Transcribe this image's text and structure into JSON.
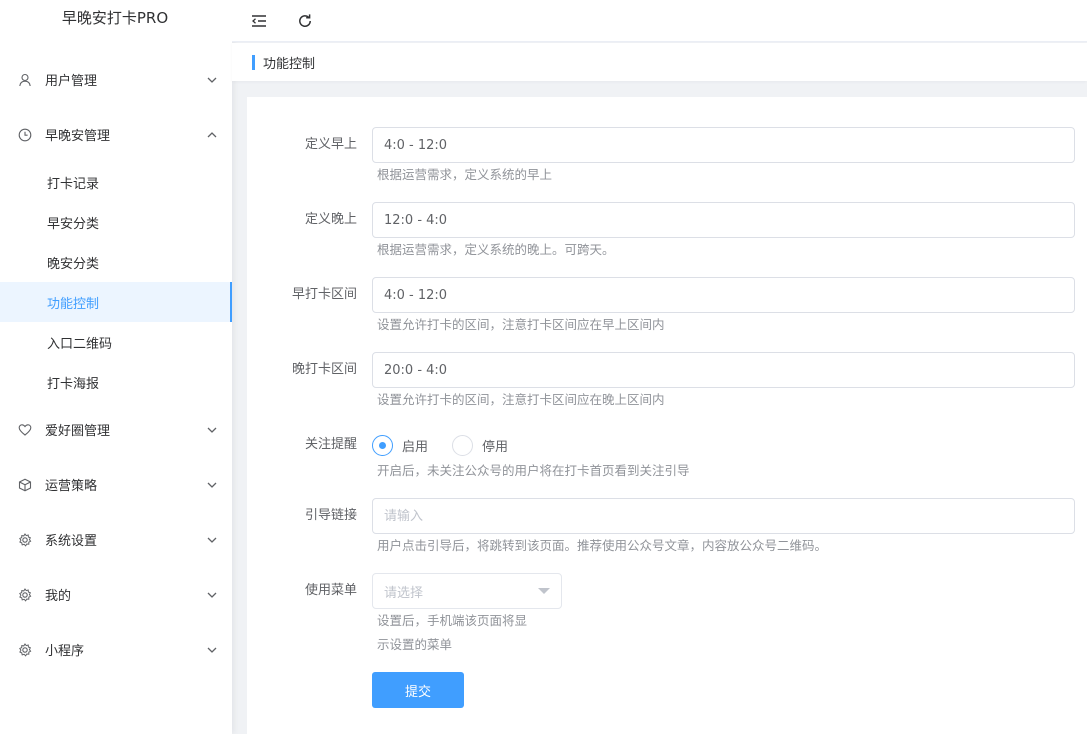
{
  "app": {
    "title": "早晚安打卡PRO"
  },
  "sidebar": {
    "items": [
      {
        "label": "用户管理",
        "icon": "user-icon",
        "expanded": false
      },
      {
        "label": "早晚安管理",
        "icon": "clock-icon",
        "expanded": true,
        "children": [
          {
            "label": "打卡记录"
          },
          {
            "label": "早安分类"
          },
          {
            "label": "晚安分类"
          },
          {
            "label": "功能控制",
            "active": true
          },
          {
            "label": "入口二维码"
          },
          {
            "label": "打卡海报"
          }
        ]
      },
      {
        "label": "爱好圈管理",
        "icon": "heart-icon",
        "expanded": false
      },
      {
        "label": "运营策略",
        "icon": "cube-icon",
        "expanded": false
      },
      {
        "label": "系统设置",
        "icon": "gear-icon",
        "expanded": false
      },
      {
        "label": "我的",
        "icon": "gear-icon",
        "expanded": false
      },
      {
        "label": "小程序",
        "icon": "gear-icon",
        "expanded": false
      }
    ]
  },
  "breadcrumb": {
    "current": "功能控制"
  },
  "form": {
    "morning": {
      "label": "定义早上",
      "value": "4:0 - 12:0",
      "help": "根据运营需求，定义系统的早上"
    },
    "evening": {
      "label": "定义晚上",
      "value": "12:0 - 4:0",
      "help": "根据运营需求，定义系统的晚上。可跨天。"
    },
    "morning_range": {
      "label": "早打卡区间",
      "value": "4:0 - 12:0",
      "help": "设置允许打卡的区间，注意打卡区间应在早上区间内"
    },
    "evening_range": {
      "label": "晚打卡区间",
      "value": "20:0 - 4:0",
      "help": "设置允许打卡的区间，注意打卡区间应在晚上区间内"
    },
    "follow_remind": {
      "label": "关注提醒",
      "options": [
        "启用",
        "停用"
      ],
      "selected": "启用",
      "help": "开启后，未关注公众号的用户将在打卡首页看到关注引导"
    },
    "guide_link": {
      "label": "引导链接",
      "value": "",
      "placeholder": "请输入",
      "help": "用户点击引导后，将跳转到该页面。推荐使用公众号文章，内容放公众号二维码。"
    },
    "menu": {
      "label": "使用菜单",
      "placeholder": "请选择",
      "help_line1": "设置后，手机端该页面将显",
      "help_line2": "示设置的菜单"
    },
    "submit_label": "提交"
  },
  "colors": {
    "accent": "#409eff",
    "active_bg": "#ecf5ff"
  }
}
